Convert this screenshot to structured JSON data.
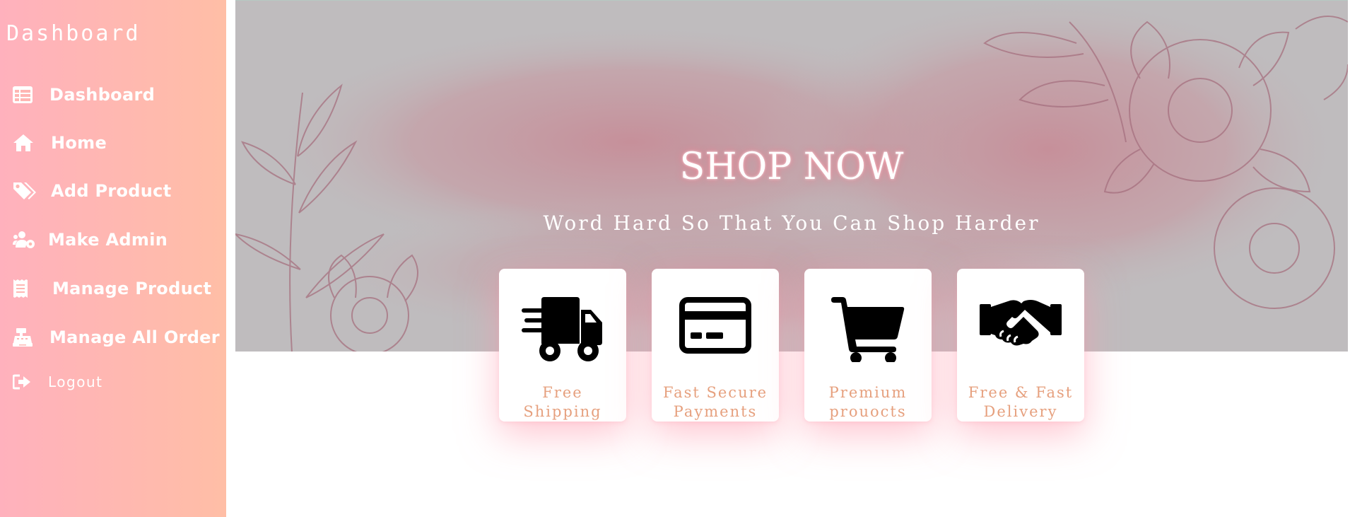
{
  "sidebar": {
    "title": "Dashboard",
    "items": [
      {
        "label": "Dashboard",
        "icon": "table-icon"
      },
      {
        "label": "Home",
        "icon": "home-icon"
      },
      {
        "label": "Add Product",
        "icon": "tags-icon"
      },
      {
        "label": "Make Admin",
        "icon": "users-cog-icon"
      },
      {
        "label": "Manage Product",
        "icon": "receipt-icon"
      },
      {
        "label": "Manage All Order",
        "icon": "cash-register-icon"
      },
      {
        "label": "Logout",
        "icon": "sign-out-icon"
      }
    ]
  },
  "hero": {
    "title": "SHOP NOW",
    "subtitle": "Word Hard So That You Can Shop Harder"
  },
  "features": [
    {
      "label": "Free Shipping",
      "icon": "shipping-fast-icon"
    },
    {
      "label": "Fast Secure Payments",
      "icon": "credit-card-icon"
    },
    {
      "label": "Premium prouocts",
      "icon": "shopping-cart-icon"
    },
    {
      "label": "Free & Fast Delivery",
      "icon": "handshake-icon"
    }
  ],
  "colors": {
    "sidebar_gradient_start": "#ffb1bd",
    "sidebar_gradient_end": "#ffbea6",
    "feature_text": "#e6a07e"
  }
}
